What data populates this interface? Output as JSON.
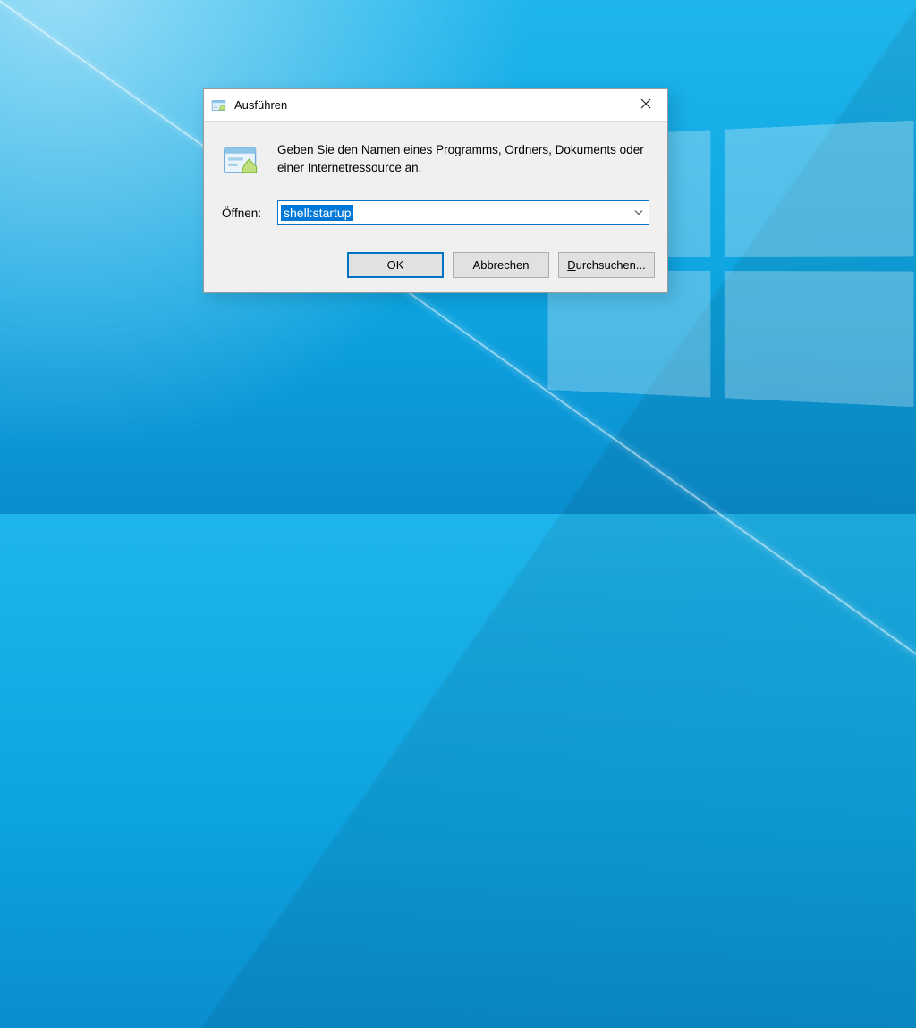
{
  "dialog": {
    "title": "Ausführen",
    "description": "Geben Sie den Namen eines Programms, Ordners, Dokuments oder einer Internetressource an.",
    "open_label": "Öffnen:",
    "input_value": "shell:startup",
    "buttons": {
      "ok": "OK",
      "cancel": "Abbrechen",
      "browse_pre": "D",
      "browse_post": "urchsuchen..."
    }
  }
}
